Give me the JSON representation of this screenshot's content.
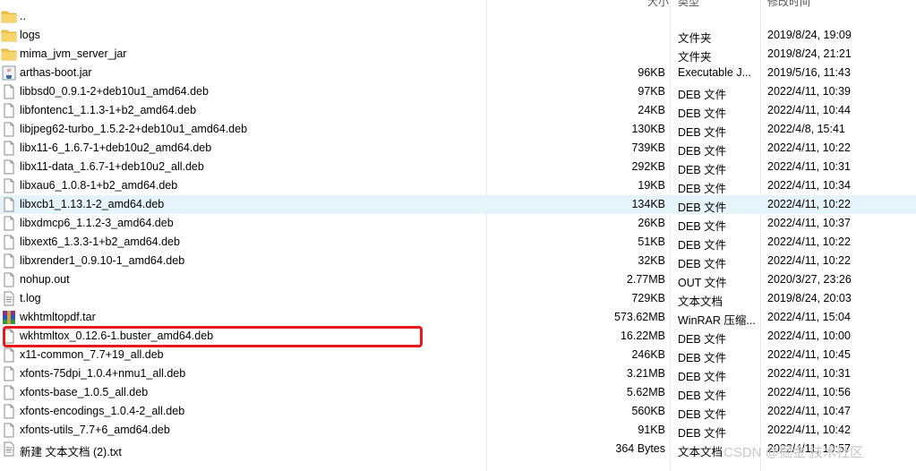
{
  "header": {
    "size_col": "大小",
    "type_col": "类型",
    "date_col": "修改时间"
  },
  "rows": [
    {
      "icon": "folder-icon",
      "name": "..",
      "size": "",
      "type": "",
      "date": ""
    },
    {
      "icon": "folder-icon",
      "name": "logs",
      "size": "",
      "type": "文件夹",
      "date": "2019/8/24, 19:09"
    },
    {
      "icon": "folder-icon",
      "name": "mima_jvm_server_jar",
      "size": "",
      "type": "文件夹",
      "date": "2019/8/24, 21:21"
    },
    {
      "icon": "java-jar-icon",
      "name": "arthas-boot.jar",
      "size": "96KB",
      "type": "Executable J...",
      "date": "2019/5/16, 11:43"
    },
    {
      "icon": "file-icon",
      "name": "libbsd0_0.9.1-2+deb10u1_amd64.deb",
      "size": "97KB",
      "type": "DEB 文件",
      "date": "2022/4/11, 10:39"
    },
    {
      "icon": "file-icon",
      "name": "libfontenc1_1.1.3-1+b2_amd64.deb",
      "size": "24KB",
      "type": "DEB 文件",
      "date": "2022/4/11, 10:44"
    },
    {
      "icon": "file-icon",
      "name": "libjpeg62-turbo_1.5.2-2+deb10u1_amd64.deb",
      "size": "130KB",
      "type": "DEB 文件",
      "date": "2022/4/8, 15:41"
    },
    {
      "icon": "file-icon",
      "name": "libx11-6_1.6.7-1+deb10u2_amd64.deb",
      "size": "739KB",
      "type": "DEB 文件",
      "date": "2022/4/11, 10:22"
    },
    {
      "icon": "file-icon",
      "name": "libx11-data_1.6.7-1+deb10u2_all.deb",
      "size": "292KB",
      "type": "DEB 文件",
      "date": "2022/4/11, 10:31"
    },
    {
      "icon": "file-icon",
      "name": "libxau6_1.0.8-1+b2_amd64.deb",
      "size": "19KB",
      "type": "DEB 文件",
      "date": "2022/4/11, 10:34"
    },
    {
      "icon": "file-icon",
      "name": "libxcb1_1.13.1-2_amd64.deb",
      "size": "134KB",
      "type": "DEB 文件",
      "date": "2022/4/11, 10:22",
      "selected": true
    },
    {
      "icon": "file-icon",
      "name": "libxdmcp6_1.1.2-3_amd64.deb",
      "size": "26KB",
      "type": "DEB 文件",
      "date": "2022/4/11, 10:37"
    },
    {
      "icon": "file-icon",
      "name": "libxext6_1.3.3-1+b2_amd64.deb",
      "size": "51KB",
      "type": "DEB 文件",
      "date": "2022/4/11, 10:22"
    },
    {
      "icon": "file-icon",
      "name": "libxrender1_0.9.10-1_amd64.deb",
      "size": "32KB",
      "type": "DEB 文件",
      "date": "2022/4/11, 10:22"
    },
    {
      "icon": "file-icon",
      "name": "nohup.out",
      "size": "2.77MB",
      "type": "OUT 文件",
      "date": "2020/3/27, 23:26"
    },
    {
      "icon": "text-doc-icon",
      "name": "t.log",
      "size": "729KB",
      "type": "文本文档",
      "date": "2019/8/24, 20:03"
    },
    {
      "icon": "winrar-archive-icon",
      "name": "wkhtmltopdf.tar",
      "size": "573.62MB",
      "type": "WinRAR 压缩...",
      "date": "2022/4/11, 15:04"
    },
    {
      "icon": "file-icon",
      "name": "wkhtmltox_0.12.6-1.buster_amd64.deb",
      "size": "16.22MB",
      "type": "DEB 文件",
      "date": "2022/4/11, 10:00"
    },
    {
      "icon": "file-icon",
      "name": "x11-common_7.7+19_all.deb",
      "size": "246KB",
      "type": "DEB 文件",
      "date": "2022/4/11, 10:45"
    },
    {
      "icon": "file-icon",
      "name": "xfonts-75dpi_1.0.4+nmu1_all.deb",
      "size": "3.21MB",
      "type": "DEB 文件",
      "date": "2022/4/11, 10:31"
    },
    {
      "icon": "file-icon",
      "name": "xfonts-base_1.0.5_all.deb",
      "size": "5.62MB",
      "type": "DEB 文件",
      "date": "2022/4/11, 10:56"
    },
    {
      "icon": "file-icon",
      "name": "xfonts-encodings_1.0.4-2_all.deb",
      "size": "560KB",
      "type": "DEB 文件",
      "date": "2022/4/11, 10:47"
    },
    {
      "icon": "file-icon",
      "name": "xfonts-utils_7.7+6_amd64.deb",
      "size": "91KB",
      "type": "DEB 文件",
      "date": "2022/4/11, 10:42"
    },
    {
      "icon": "text-doc-icon",
      "name": "新建 文本文档 (2).txt",
      "size": "364 Bytes",
      "type": "文本文档",
      "date": "2022/4/11, 10:57"
    }
  ],
  "watermark": "CSDN @掘金 技术社区",
  "colors": {
    "selection": "#e5f3fb",
    "highlight_border": "#e8191c",
    "folder": "#f3c34a"
  }
}
